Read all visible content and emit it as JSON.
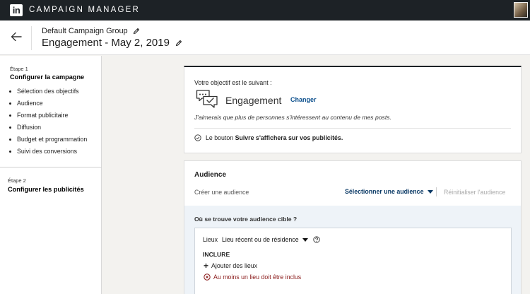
{
  "topbar": {
    "logo_text": "in",
    "app_title": "CAMPAIGN MANAGER"
  },
  "header": {
    "group_name": "Default Campaign Group",
    "campaign_name": "Engagement - May 2, 2019"
  },
  "sidebar": {
    "step1": {
      "label": "Étape 1",
      "title": "Configurer la campagne",
      "items": [
        "Sélection des objectifs",
        "Audience",
        "Format publicitaire",
        "Diffusion",
        "Budget et programmation",
        "Suivi des conversions"
      ]
    },
    "step2": {
      "label": "Étape 2",
      "title": "Configurer les publicités"
    }
  },
  "objective": {
    "intro": "Votre objectif est le suivant :",
    "name": "Engagement",
    "change_label": "Changer",
    "description": "J'aimerais que plus de personnes s'intéressent au contenu de mes posts.",
    "note_prefix": "Le bouton ",
    "note_bold": "Suivre s'affichera sur vos publicités."
  },
  "audience": {
    "title": "Audience",
    "create_label": "Créer une audience",
    "select_label": "Sélectionner une audience",
    "reset_label": "Réinitialiser l'audience",
    "question": "Où se trouve votre audience cible ?",
    "locations_label": "Lieux",
    "location_type": "Lieu récent ou de résidence",
    "include_label": "INCLURE",
    "add_locations_label": "Ajouter des lieux",
    "error_text": "Au moins un lieu doit être inclus"
  },
  "colors": {
    "topbar_bg": "#1d2226",
    "link_blue": "#0a4e8c",
    "error_red": "#8a1a1a",
    "page_bg": "#f3f2ef",
    "inner_bg": "#eef3f8"
  }
}
